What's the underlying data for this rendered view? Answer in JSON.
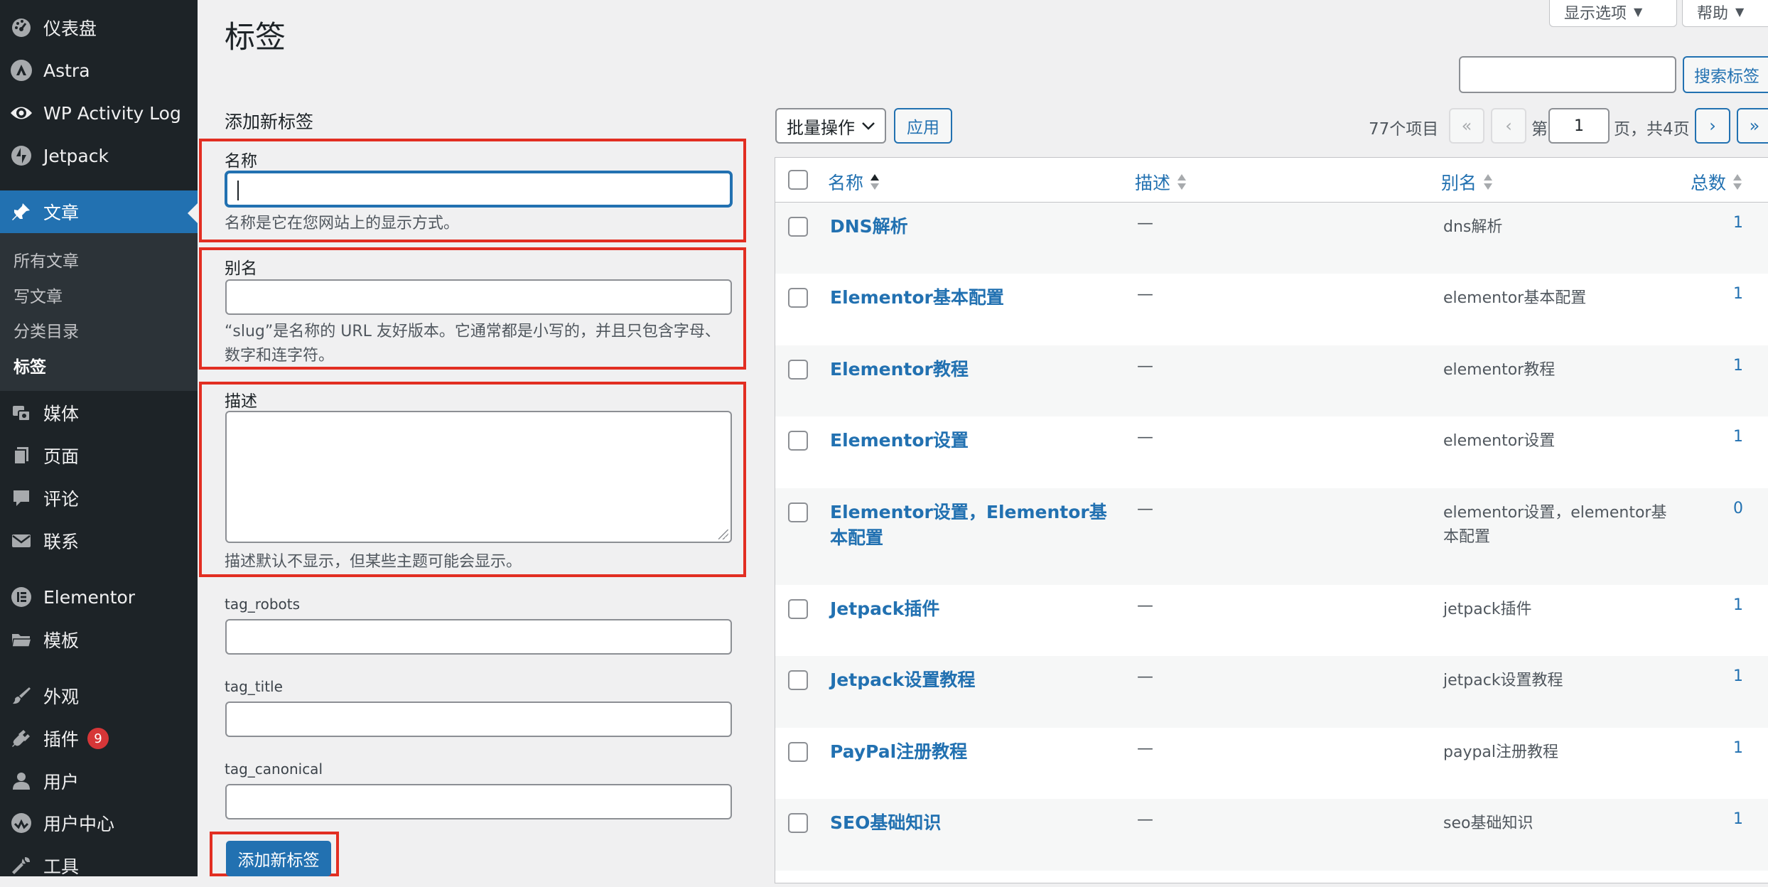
{
  "sidebar": {
    "items": [
      {
        "label": "仪表盘",
        "icon": "dashboard-icon"
      },
      {
        "label": "Astra",
        "icon": "astra-icon"
      },
      {
        "label": "WP Activity Log",
        "icon": "eye-icon"
      },
      {
        "label": "Jetpack",
        "icon": "jetpack-icon"
      },
      {
        "label": "文章",
        "icon": "pin-icon"
      },
      {
        "label": "媒体",
        "icon": "media-icon"
      },
      {
        "label": "页面",
        "icon": "page-icon"
      },
      {
        "label": "评论",
        "icon": "comment-icon"
      },
      {
        "label": "联系",
        "icon": "mail-icon"
      },
      {
        "label": "Elementor",
        "icon": "elementor-icon"
      },
      {
        "label": "模板",
        "icon": "folder-icon"
      },
      {
        "label": "外观",
        "icon": "brush-icon"
      },
      {
        "label": "插件",
        "icon": "plugin-icon",
        "badge": "9"
      },
      {
        "label": "用户",
        "icon": "user-icon"
      },
      {
        "label": "用户中心",
        "icon": "user-center-icon"
      },
      {
        "label": "工具",
        "icon": "wrench-icon"
      }
    ],
    "submenu": [
      "所有文章",
      "写文章",
      "分类目录",
      "标签"
    ]
  },
  "header": {
    "title": "标签",
    "screen_options": "显示选项",
    "help": "帮助"
  },
  "form": {
    "heading": "添加新标签",
    "name_label": "名称",
    "name_value": "",
    "name_help": "名称是它在您网站上的显示方式。",
    "slug_label": "别名",
    "slug_value": "",
    "slug_help": "“slug”是名称的 URL 友好版本。它通常都是小写的，并且只包含字母、数字和连字符。",
    "desc_label": "描述",
    "desc_help": "描述默认不显示，但某些主题可能会显示。",
    "tag_robots_label": "tag_robots",
    "tag_title_label": "tag_title",
    "tag_canonical_label": "tag_canonical",
    "submit": "添加新标签"
  },
  "search": {
    "placeholder": "",
    "button": "搜索标签"
  },
  "toolbar": {
    "bulk_actions": "批量操作",
    "apply": "应用",
    "items_count": "77个项目",
    "first": "«",
    "prev": "‹",
    "page_prefix": "第",
    "page_current": "1",
    "page_suffix": "页，共4页",
    "next": "›",
    "last": "»"
  },
  "table": {
    "columns": [
      "名称",
      "描述",
      "别名",
      "总数"
    ],
    "rows": [
      {
        "name": "DNS解析",
        "desc": "—",
        "slug": "dns解析",
        "count": "1"
      },
      {
        "name": "Elementor基本配置",
        "desc": "—",
        "slug": "elementor基本配置",
        "count": "1"
      },
      {
        "name": "Elementor教程",
        "desc": "—",
        "slug": "elementor教程",
        "count": "1"
      },
      {
        "name": "Elementor设置",
        "desc": "—",
        "slug": "elementor设置",
        "count": "1"
      },
      {
        "name": "Elementor设置，Elementor基本配置",
        "desc": "—",
        "slug": "elementor设置，elementor基本配置",
        "count": "0"
      },
      {
        "name": "Jetpack插件",
        "desc": "—",
        "slug": "jetpack插件",
        "count": "1"
      },
      {
        "name": "Jetpack设置教程",
        "desc": "—",
        "slug": "jetpack设置教程",
        "count": "1"
      },
      {
        "name": "PayPal注册教程",
        "desc": "—",
        "slug": "paypal注册教程",
        "count": "1"
      },
      {
        "name": "SEO基础知识",
        "desc": "—",
        "slug": "seo基础知识",
        "count": "1"
      }
    ]
  },
  "colors": {
    "sidebar_bg": "#1d2327",
    "accent": "#2271b1",
    "highlight_border": "#e22e22",
    "badge": "#d63638"
  }
}
